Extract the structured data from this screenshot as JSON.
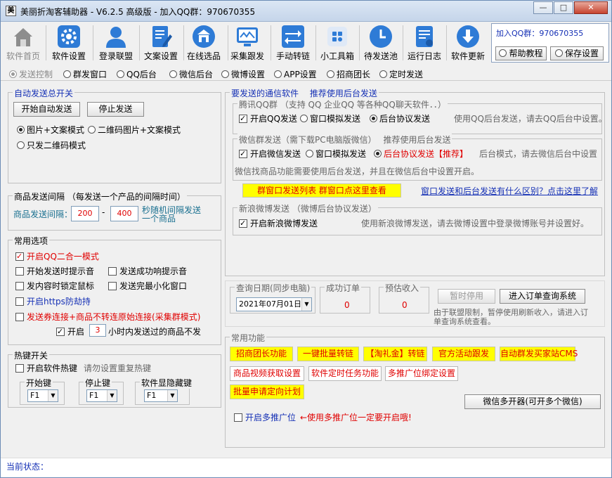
{
  "window": {
    "title": "美丽折淘客辅助器 - V6.2.5 高级版 - 加入QQ群：970670355",
    "app_icon_glyph": "美",
    "minimize": "—",
    "maximize": "□",
    "close": "✕"
  },
  "toolbar": {
    "items": [
      {
        "label": "软件首页",
        "icon": "home-icon"
      },
      {
        "label": "软件设置",
        "icon": "gear-icon"
      },
      {
        "label": "登录联盟",
        "icon": "user-icon"
      },
      {
        "label": "文案设置",
        "icon": "document-edit-icon"
      },
      {
        "label": "在线选品",
        "icon": "store-icon"
      },
      {
        "label": "采集跟发",
        "icon": "monitor-icon"
      },
      {
        "label": "手动转链",
        "icon": "swap-arrows-icon"
      },
      {
        "label": "小工具箱",
        "icon": "toolbox-icon"
      },
      {
        "label": "待发送池",
        "icon": "clock-icon"
      },
      {
        "label": "运行日志",
        "icon": "log-icon"
      },
      {
        "label": "软件更新",
        "icon": "download-icon"
      }
    ],
    "qq_group": "加入QQ群：970670355",
    "help_label": "帮助教程",
    "save_label": "保存设置"
  },
  "tabs": [
    {
      "label": "发送控制",
      "selected": true
    },
    {
      "label": "群发窗口"
    },
    {
      "label": "QQ后台"
    },
    {
      "label": "微信后台"
    },
    {
      "label": "微博设置"
    },
    {
      "label": "APP设置"
    },
    {
      "label": "招商团长"
    },
    {
      "label": "定时发送"
    }
  ],
  "auto_send": {
    "legend": "自动发送总开关",
    "start_label": "开始自动发送",
    "stop_label": "停止发送",
    "mode_image_text": "图片+文案模式",
    "mode_qr_text": "二维码图片+文案模式",
    "mode_qr_only": "只发二维码模式"
  },
  "interval": {
    "legend": "商品发送间隔 （每发送一个产品的间隔时间）",
    "label": "商品发送间隔：",
    "min": "200",
    "dash": "-",
    "max": "400",
    "note_line1": "秒随机间隔发送",
    "note_line2": "一个商品"
  },
  "common_options": {
    "legend": "常用选项",
    "qq_2in1": "开启QQ二合一模式",
    "start_prompt": "开始发送时提示音",
    "success_prompt": "发送成功响提示音",
    "lock_mouse": "发内容时锁定鼠标",
    "minimize_after": "发送完最小化窗口",
    "https_hijack": "开启https防劫持",
    "coupon_link": "发送券连接+商品不转连原始连接(采集群模式)",
    "enable": "开启",
    "hours": "3",
    "hours_note": "小时内发送过的商品不发"
  },
  "hotkeys": {
    "legend": "热键开关",
    "enable_label": "开启软件热键",
    "enable_note": "请勿设置重复热键",
    "start_key_label": "开始键",
    "stop_key_label": "停止键",
    "toggle_key_label": "软件显隐藏键",
    "start_key": "F1",
    "stop_key": "F1",
    "toggle_key": "F1"
  },
  "channels": {
    "legend": "要发送的通信软件",
    "legend_hint": "推荐使用后台发送",
    "qq": {
      "legend": "腾讯QQ群 （支持 QQ 企业QQ 等各种QQ聊天软件．．）",
      "enable": "开启QQ发送",
      "window_mode": "窗口模拟发送",
      "backend_mode": "后台协议发送",
      "note": "使用QQ后台发送，请去QQ后台中设置。"
    },
    "wechat": {
      "legend": "微信群发送（需下载PC电脑版微信）",
      "legend_hint": "推荐使用后台发送",
      "enable": "开启微信发送",
      "window_mode": "窗口模拟发送",
      "backend_mode": "后台协议发送【推荐】",
      "note": "后台模式，请去微信后台中设置",
      "note2": "微信找商品功能需要使用后台发送，并且在微信后台中设置开启。"
    },
    "group_list_button": "群窗口发送列表 群窗口点这里查看",
    "diff_link": "窗口发送和后台发送有什么区别？点击这里了解",
    "weibo": {
      "legend": "新浪微博发送 （微博后台协议发送）",
      "enable": "开启新浪微博发送",
      "note": "使用新浪微博发送，请去微博设置中登录微博账号并设置好。"
    }
  },
  "orders": {
    "date_legend": "查询日期(同步电脑)",
    "date_value": "2021年07月01日",
    "success_legend": "成功订单",
    "success_value": "0",
    "estimate_legend": "预估收入",
    "estimate_value": "0",
    "pause_label": "暂时停用",
    "query_label": "进入订单查询系统",
    "note_line1": "由于联盟限制，暂停使用刷新收入，请进入订",
    "note_line2": "单查询系统查看。"
  },
  "functions": {
    "legend": "常用功能",
    "row1": [
      "招商团长功能",
      "一键批量转链",
      "【淘礼金】转链",
      "官方活动跟发",
      "自动群发买家站CMS"
    ],
    "row2": [
      "商品视频获取设置",
      "软件定时任务功能",
      "多推广位绑定设置"
    ],
    "batch_plan": "批量申请定向计划",
    "multi_wechat": "微信多开器(可开多个微信)",
    "multi_pid": "开启多推广位",
    "multi_pid_note": "←使用多推广位一定要开启哦!"
  },
  "status": {
    "label": "当前状态："
  },
  "colors": {
    "accent_blue": "#1530b5",
    "red": "#e00000",
    "yellow": "#ffff00",
    "toolbar_icon_blue": "#2e7bd6"
  }
}
